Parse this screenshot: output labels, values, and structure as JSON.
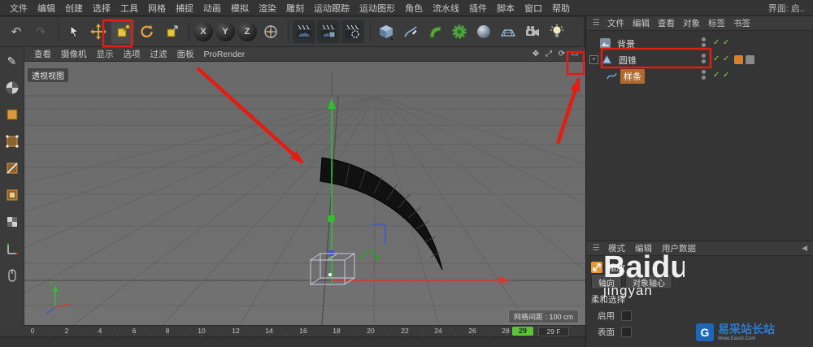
{
  "menubar": {
    "items": [
      "文件",
      "编辑",
      "创建",
      "选择",
      "工具",
      "网格",
      "捕捉",
      "动画",
      "模拟",
      "渲染",
      "雕刻",
      "运动跟踪",
      "运动图形",
      "角色",
      "流水线",
      "插件",
      "脚本",
      "窗口",
      "帮助"
    ],
    "right_label": "界面: 启.."
  },
  "toolbar": {
    "axis_locks": [
      "X",
      "Y",
      "Z"
    ],
    "icons": [
      "undo",
      "redo",
      "live-select",
      "move",
      "scale",
      "rotate",
      "last-used-tool",
      "x-axis-lock",
      "y-axis-lock",
      "z-axis-lock",
      "coordinate-system",
      "render-to-view",
      "render-in-picture-viewer",
      "edit-render-settings",
      "add-primitive-cube",
      "pen-spline",
      "bend-deformer",
      "mograph",
      "simulate",
      "floor",
      "camera",
      "light"
    ]
  },
  "left_toolbar": {
    "icons": [
      "convert-editable",
      "texture-ball",
      "model-mode",
      "points-mode",
      "edges-mode",
      "polygons-mode",
      "texture-mode",
      "axis-mode",
      "mouse"
    ]
  },
  "viewport": {
    "menu": [
      "查看",
      "摄像机",
      "显示",
      "选项",
      "过滤",
      "面板"
    ],
    "prorender_label": "ProRender",
    "view_label": "透视视图",
    "grid_spacing_label": "网格间距 : 100 cm",
    "nav_icons": [
      "pan",
      "zoom",
      "orbit",
      "toggle-view"
    ]
  },
  "object_manager": {
    "menu": [
      "文件",
      "编辑",
      "查看",
      "对象",
      "标签",
      "书签"
    ],
    "objects": [
      {
        "name": "背景"
      },
      {
        "name": "圆锥"
      },
      {
        "name": "样条"
      }
    ]
  },
  "attributes": {
    "tabs": [
      "模式",
      "编辑",
      "用户数据"
    ],
    "title": "缩放",
    "option_buttons": [
      "轴向",
      "对象轴心"
    ],
    "section_label": "柔和选择",
    "rows": [
      {
        "label": "启用"
      },
      {
        "label": "表面"
      }
    ]
  },
  "timeline": {
    "ticks": [
      "0",
      "2",
      "4",
      "6",
      "8",
      "10",
      "12",
      "14",
      "16",
      "18",
      "20",
      "22",
      "24",
      "26",
      "28"
    ],
    "current_frame": "29",
    "frame_field": "29 F"
  },
  "watermarks": {
    "brand_main": "Baidu",
    "brand_sub": "jingyan",
    "site_name": "易采站长站",
    "site_url": "Www.Easck.Com",
    "site_initial": "G"
  },
  "colors": {
    "annotation_red": "#e51c12",
    "selection_orange": "#b06a2e",
    "check_green": "#8ed04a",
    "axis_green": "#2fbf2f",
    "axis_red": "#d23b2f",
    "timeline_green": "#5ec437"
  }
}
